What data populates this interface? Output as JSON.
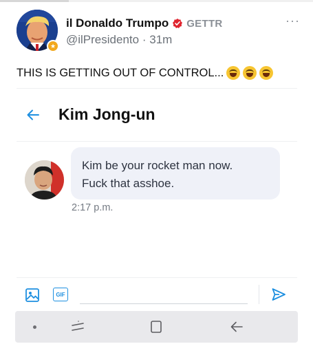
{
  "post": {
    "display_name": "il Donaldo Trumpo",
    "brand": "GETTR",
    "handle": "@ilPresidento",
    "separator": "·",
    "time_ago": "31m",
    "more_label": "···",
    "text": "THIS IS GETTING OUT OF CONTROL...",
    "emojis": [
      "face-with-tears-of-joy",
      "face-with-tears-of-joy",
      "face-with-tears-of-joy"
    ],
    "verified_icon": "verified-badge-icon",
    "verified_color": "#e0242f"
  },
  "chat": {
    "title": "Kim Jong-un",
    "back_icon": "back-arrow-icon",
    "message_lines": [
      "Kim be your rocket man now.",
      "Fuck that asshoe."
    ],
    "timestamp": "2:17 p.m."
  },
  "composer": {
    "image_icon": "image-icon",
    "gif_label": "GIF",
    "input_value": "",
    "send_icon": "send-icon",
    "accent": "#1d8fe0"
  },
  "navbar": {
    "buttons": [
      "nav-dot",
      "recents-icon",
      "home-icon",
      "back-icon"
    ]
  }
}
